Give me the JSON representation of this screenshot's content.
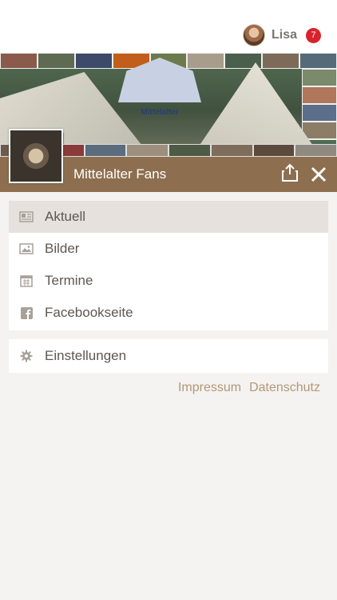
{
  "user": {
    "name": "Lisa",
    "notifications": "7"
  },
  "banner": {
    "sign_text": "Mittelalter"
  },
  "page": {
    "title": "Mittelalter Fans"
  },
  "menu": {
    "items": [
      {
        "label": "Aktuell",
        "icon": "newspaper-icon",
        "active": true
      },
      {
        "label": "Bilder",
        "icon": "image-icon",
        "active": false
      },
      {
        "label": "Termine",
        "icon": "calendar-icon",
        "active": false
      },
      {
        "label": "Facebookseite",
        "icon": "facebook-icon",
        "active": false
      }
    ],
    "settings": {
      "label": "Einstellungen",
      "icon": "gear-icon"
    }
  },
  "footer": {
    "impressum": "Impressum",
    "datenschutz": "Datenschutz"
  },
  "colors": {
    "accent": "#8d6f4f",
    "badge": "#d9232c",
    "link": "#b29877",
    "active_bg": "#e6e1dc"
  }
}
